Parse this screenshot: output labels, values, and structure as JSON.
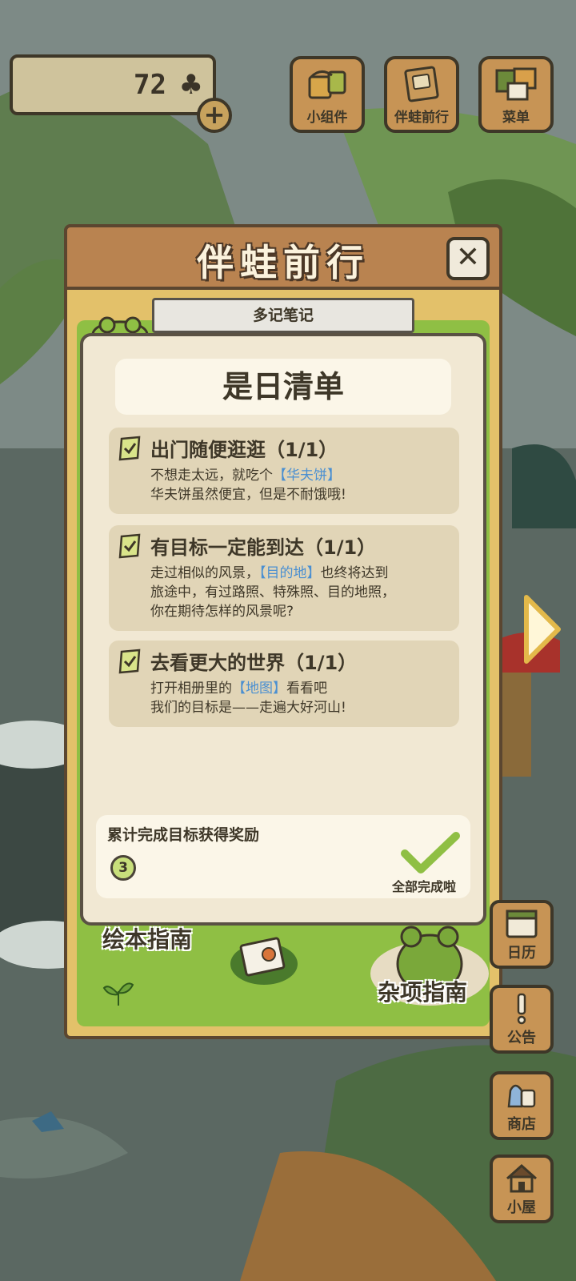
{
  "top_bar": {
    "clover_count": "72",
    "buttons": [
      {
        "label": "小组件",
        "icon": "widget-icon"
      },
      {
        "label": "伴蛙前行",
        "icon": "travel-book-icon"
      },
      {
        "label": "菜单",
        "icon": "menu-icon"
      }
    ]
  },
  "panel": {
    "title": "伴蛙前行",
    "tab_label": "多记笔记",
    "checklist_title": "是日清单",
    "items": [
      {
        "title": "出门随便逛逛（1/1）",
        "line1_pre": "不想走太远，就吃个",
        "line1_link": "【华夫饼】",
        "line1_post": "",
        "line2": "华夫饼虽然便宜，但是不耐饿哦!",
        "line3": ""
      },
      {
        "title": "有目标一定能到达（1/1）",
        "line1_pre": "走过相似的风景，",
        "line1_link": "【目的地】",
        "line1_post": "也终将达到",
        "line2": "旅途中，有过路照、特殊照、目的地照，",
        "line3": "你在期待怎样的风景呢?"
      },
      {
        "title": "去看更大的世界（1/1）",
        "line1_pre": "打开相册里的",
        "line1_link": "【地图】",
        "line1_post": "看看吧",
        "line2": "我们的目标是——走遍大好河山!",
        "line3": ""
      }
    ],
    "reward": {
      "title": "累计完成目标获得奖励",
      "count": "3",
      "status": "全部完成啦"
    },
    "guides": {
      "picture_book": "绘本指南",
      "misc": "杂项指南"
    }
  },
  "side_menu": [
    {
      "label": "日历",
      "icon": "calendar-icon"
    },
    {
      "label": "公告",
      "icon": "notice-icon"
    },
    {
      "label": "商店",
      "icon": "shop-icon"
    },
    {
      "label": "小屋",
      "icon": "house-icon"
    }
  ],
  "colors": {
    "panel_yellow": "#e3c16a",
    "header_wood": "#b98350",
    "card_bg": "#f1e8d3",
    "item_bg": "#e1d5b7",
    "link_blue": "#4a8fd1",
    "grass_green": "#8fbf44",
    "button_wood": "#c79455"
  }
}
